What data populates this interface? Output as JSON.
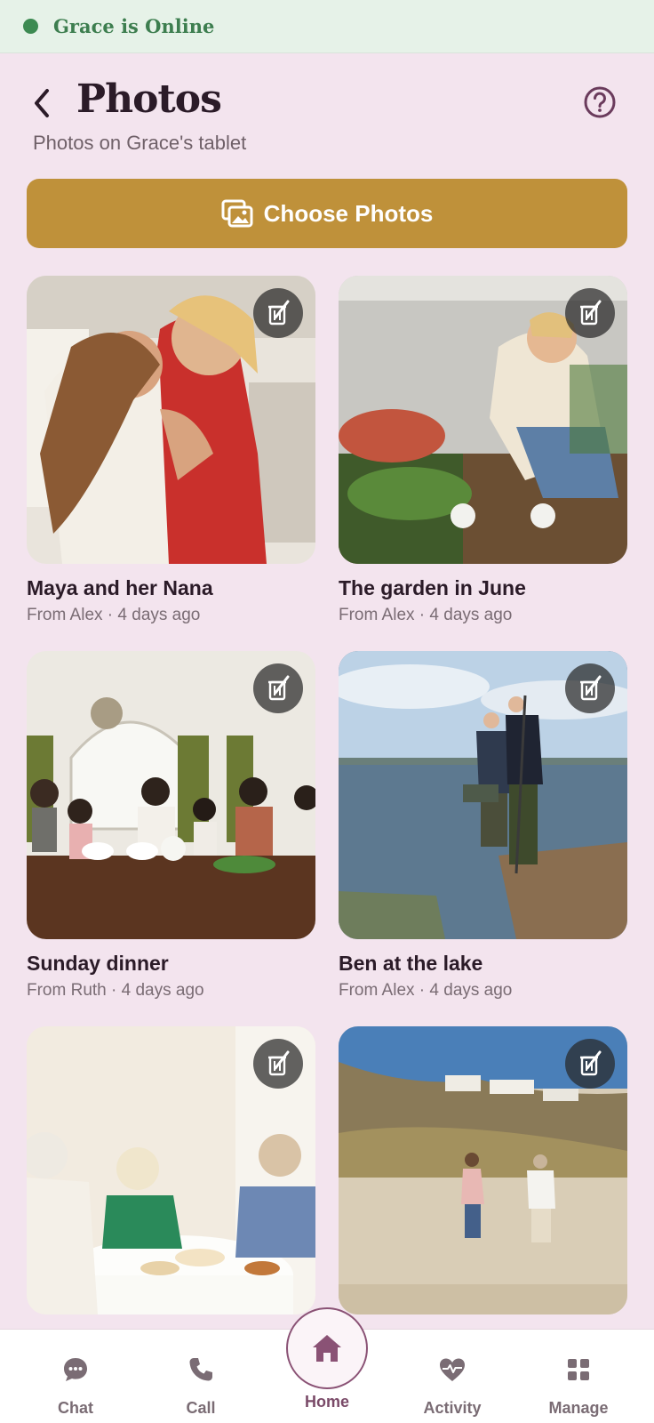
{
  "status": {
    "text": "Grace is Online",
    "color": "#3d8a52"
  },
  "header": {
    "back_icon": "chevron-left-icon",
    "title": "Photos",
    "subtitle": "Photos on Grace's tablet",
    "help_icon": "help-circle-icon"
  },
  "choose_button": {
    "label": "Choose Photos",
    "icon": "image-gallery-icon",
    "color": "#bf913a"
  },
  "photos": [
    {
      "title": "Maya and her Nana",
      "meta": "From Alex · 4 days ago",
      "action_icon": "edit-delete-icon"
    },
    {
      "title": "The garden in June",
      "meta": "From Alex · 4 days ago",
      "action_icon": "edit-delete-icon"
    },
    {
      "title": "Sunday dinner",
      "meta": "From Ruth · 4 days ago",
      "action_icon": "edit-delete-icon"
    },
    {
      "title": "Ben at the lake",
      "meta": "From Alex · 4 days ago",
      "action_icon": "edit-delete-icon"
    },
    {
      "title": "",
      "meta": "",
      "action_icon": "edit-delete-icon"
    },
    {
      "title": "",
      "meta": "",
      "action_icon": "edit-delete-icon"
    }
  ],
  "nav": {
    "items": [
      {
        "label": "Chat",
        "icon": "chat-bubble-icon"
      },
      {
        "label": "Call",
        "icon": "phone-icon"
      },
      {
        "label": "Home",
        "icon": "home-icon",
        "active": true
      },
      {
        "label": "Activity",
        "icon": "heart-pulse-icon"
      },
      {
        "label": "Manage",
        "icon": "grid-icon"
      }
    ],
    "accent": "#8a5275"
  }
}
